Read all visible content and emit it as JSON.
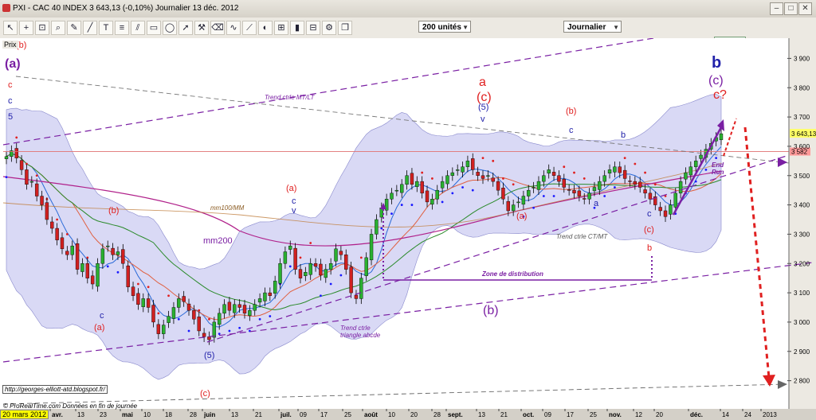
{
  "window": {
    "title": "PXI - CAC 40 INDEX    3 643,13 (-0,10%)    Journalier  13 déc. 2012"
  },
  "toolbar": {
    "units_select": "200 unités",
    "period_select": "Journalier"
  },
  "axis_label": "Prix",
  "footer": {
    "credit": "© ProRealTime.com  Données en fin de journée",
    "url": "http://georges-elliott-atd.blogspot.fr/",
    "start_date": "20 mars 2012"
  },
  "colors": {
    "bg": "#ffffff",
    "band": "#c4c4f0",
    "red": "#e02020",
    "blue": "#2222aa",
    "purple": "#7a1fa3",
    "dots_blue": "#1a1aff",
    "dots_red": "#e02020"
  },
  "chart_data": {
    "type": "candlestick",
    "title": "",
    "ylim": [
      2750,
      3950
    ],
    "y_ticks": [
      "3 900",
      "3 800",
      "3 700",
      "3 600",
      "3 500",
      "3 400",
      "3 300",
      "3 200",
      "3 100",
      "3 000",
      "2 900",
      "2 800"
    ],
    "x_ticks": [
      "avr.",
      "13",
      "23",
      "mai",
      "10",
      "18",
      "28",
      "juin",
      "13",
      "21",
      "juil.",
      "09",
      "17",
      "25",
      "août",
      "10",
      "20",
      "28",
      "sept.",
      "13",
      "21",
      "oct.",
      "09",
      "17",
      "25",
      "nov.",
      "12",
      "20",
      "déc.",
      "14",
      "24",
      "2013"
    ],
    "last_price_label": "3 643,13",
    "level_label": "3 582",
    "close_series": [
      3565,
      3585,
      3560,
      3520,
      3470,
      3480,
      3430,
      3400,
      3350,
      3320,
      3280,
      3250,
      3230,
      3260,
      3180,
      3200,
      3150,
      3130,
      3200,
      3250,
      3260,
      3230,
      3240,
      3200,
      3120,
      3090,
      3060,
      3080,
      3050,
      3000,
      2960,
      2990,
      3020,
      3050,
      3080,
      3070,
      3040,
      3010,
      2970,
      2950,
      2940,
      3000,
      3030,
      3060,
      3040,
      3060,
      3050,
      3030,
      3040,
      3060,
      3080,
      3100,
      3090,
      3140,
      3200,
      3240,
      3260,
      3180,
      3150,
      3170,
      3200,
      3190,
      3160,
      3180,
      3200,
      3250,
      3230,
      3180,
      3100,
      3080,
      3150,
      3220,
      3300,
      3350,
      3390,
      3420,
      3440,
      3450,
      3470,
      3500,
      3470,
      3480,
      3440,
      3410,
      3420,
      3450,
      3480,
      3500,
      3510,
      3520,
      3530,
      3550,
      3520,
      3500,
      3490,
      3500,
      3480,
      3450,
      3420,
      3380,
      3400,
      3410,
      3430,
      3450,
      3460,
      3480,
      3500,
      3520,
      3500,
      3480,
      3460,
      3450,
      3440,
      3430,
      3420,
      3440,
      3460,
      3480,
      3500,
      3520,
      3530,
      3510,
      3490,
      3480,
      3470,
      3460,
      3440,
      3420,
      3400,
      3380,
      3360,
      3400,
      3440,
      3480,
      3510,
      3530,
      3550,
      3570,
      3590,
      3610,
      3630,
      3643
    ],
    "annotations": [
      {
        "text": "(a)",
        "color": "purple",
        "size": 16,
        "bold": true
      },
      {
        "text": "c",
        "color": "red"
      },
      {
        "text": "c",
        "color": "blue"
      },
      {
        "text": "5",
        "color": "blue"
      },
      {
        "text": "b",
        "color": "blue",
        "size": 20,
        "bold": true
      },
      {
        "text": "(c)",
        "color": "purple",
        "size": 16
      },
      {
        "text": "c?",
        "color": "red",
        "size": 16
      },
      {
        "text": "a",
        "color": "red",
        "size": 16
      },
      {
        "text": "(c)",
        "color": "red",
        "size": 16
      },
      {
        "text": "(5)",
        "color": "blue"
      },
      {
        "text": "v",
        "color": "blue"
      },
      {
        "text": "(b)",
        "color": "red"
      },
      {
        "text": "c",
        "color": "blue"
      },
      {
        "text": "b",
        "color": "blue"
      },
      {
        "text": "Trend ctrle MT/LT",
        "color": "purple"
      },
      {
        "text": "End Run",
        "color": "purple"
      },
      {
        "text": "(a)",
        "color": "red"
      },
      {
        "text": "a",
        "color": "blue"
      },
      {
        "text": "c",
        "color": "blue"
      },
      {
        "text": "(c)",
        "color": "red"
      },
      {
        "text": "b",
        "color": "red"
      },
      {
        "text": "Trend ctrle CT/MT",
        "color": "gray"
      },
      {
        "text": "Zone de distribution",
        "color": "purple"
      },
      {
        "text": "(a)",
        "color": "red"
      },
      {
        "text": "c",
        "color": "blue"
      },
      {
        "text": "v",
        "color": "blue"
      },
      {
        "text": "(b)",
        "color": "red"
      },
      {
        "text": "mm100/MM",
        "color": "brown"
      },
      {
        "text": "mm200",
        "color": "purple"
      },
      {
        "text": "(a)",
        "color": "red"
      },
      {
        "text": "c",
        "color": "blue"
      },
      {
        "text": "(5)",
        "color": "blue"
      },
      {
        "text": "(c)",
        "color": "red"
      },
      {
        "text": "(b)",
        "color": "purple",
        "size": 16
      },
      {
        "text": "Trend ctrle triangle abcde",
        "color": "purple"
      },
      {
        "text": "(b)",
        "color": "red"
      }
    ]
  }
}
